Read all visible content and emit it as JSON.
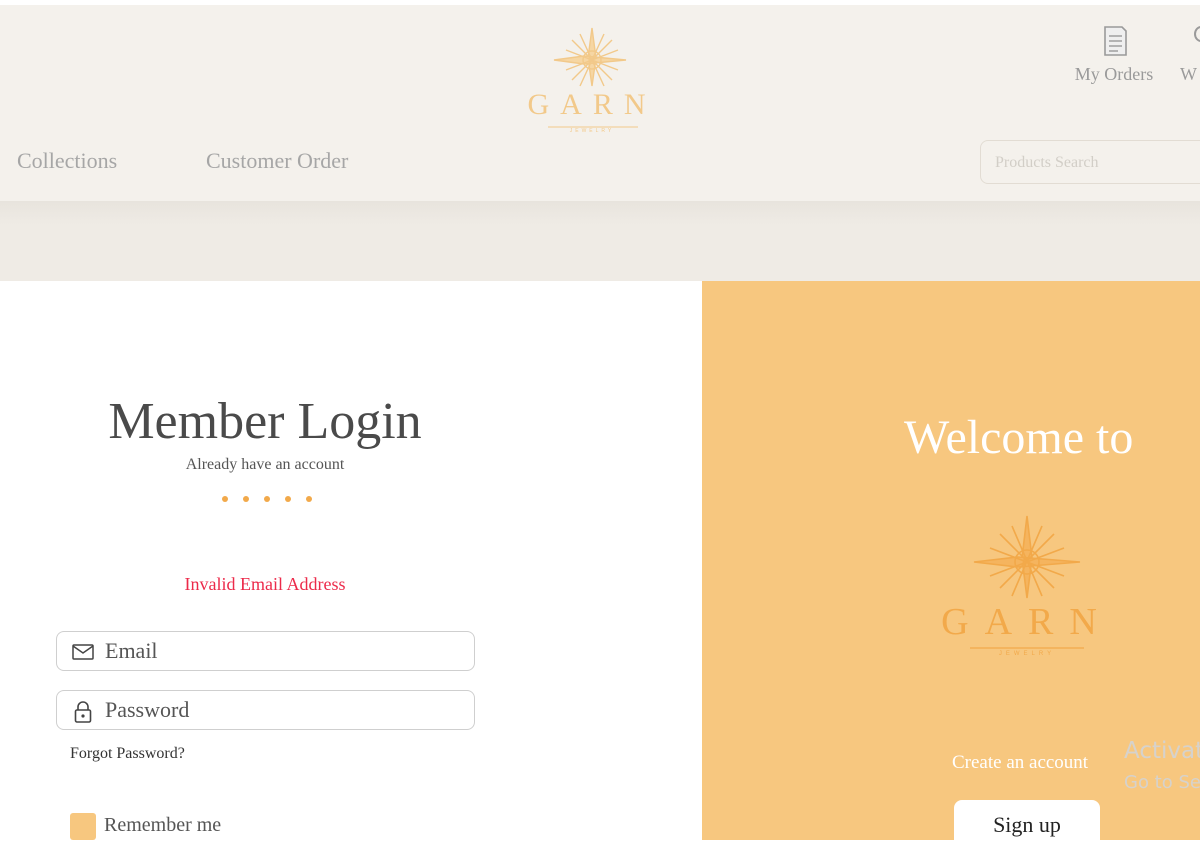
{
  "brand": {
    "name": "GARN",
    "tagline": "JEWELRY",
    "gold": "#f2a94a",
    "peach": "#f7c77f"
  },
  "header": {
    "my_orders_label": "My Orders",
    "my_orders_icon": "receipt-icon",
    "wishlist_label_partial": "W",
    "nav": [
      "Collections",
      "Customer Order"
    ],
    "search_placeholder": "Products Search"
  },
  "login": {
    "title": "Member Login",
    "subtitle": "Already have an account",
    "error": "Invalid Email Address",
    "email_placeholder": "Email",
    "email_icon": "envelope-icon",
    "password_placeholder": "Password",
    "password_icon": "lock-icon",
    "forgot_label": "Forgot Password?",
    "remember_label": "Remember me",
    "remember_checked": false
  },
  "welcome_panel": {
    "heading": "Welcome to",
    "create_label": "Create an account",
    "signup_label": "Sign up"
  },
  "watermark": {
    "line1": "Activat",
    "line2": "Go to Se"
  }
}
